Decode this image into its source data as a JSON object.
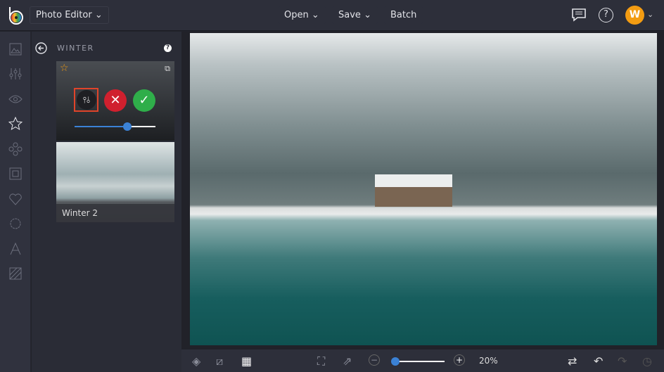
{
  "header": {
    "app_title": "Photo Editor",
    "open_label": "Open",
    "save_label": "Save",
    "batch_label": "Batch",
    "user_initial": "W"
  },
  "panel": {
    "title": "WINTER",
    "effect_name": "Winter 2",
    "slider_value": 0.65
  },
  "footer": {
    "zoom": "20%"
  },
  "colors": {
    "accent": "#f39c12",
    "cancel": "#d0202e",
    "apply": "#2fae4a",
    "slider": "#3b82d6",
    "highlight": "#e0442a"
  }
}
